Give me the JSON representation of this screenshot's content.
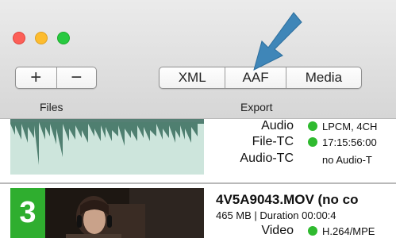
{
  "toolbar": {
    "files": {
      "add_label": "+",
      "remove_label": "−",
      "group_label": "Files"
    },
    "export": {
      "xml_label": "XML",
      "aaf_label": "AAF",
      "media_label": "Media",
      "group_label": "Export"
    }
  },
  "clips": [
    {
      "rows": [
        {
          "key": "Audio",
          "value": "LPCM, 4CH"
        },
        {
          "key": "File-TC",
          "value": "17:15:56:00"
        },
        {
          "key": "Audio-TC",
          "value": "no Audio-T"
        }
      ]
    },
    {
      "number": "3",
      "filename": "4V5A9043.MOV (no co",
      "subline": "465 MB | Duration 00:00:4",
      "rows": [
        {
          "key": "Video",
          "value": "H.264/MPE"
        }
      ]
    }
  ],
  "colors": {
    "status_ok": "#2fba2f",
    "badge": "#2fae2f",
    "arrow": "#3f86b8",
    "waveform": "#4f7f70"
  }
}
